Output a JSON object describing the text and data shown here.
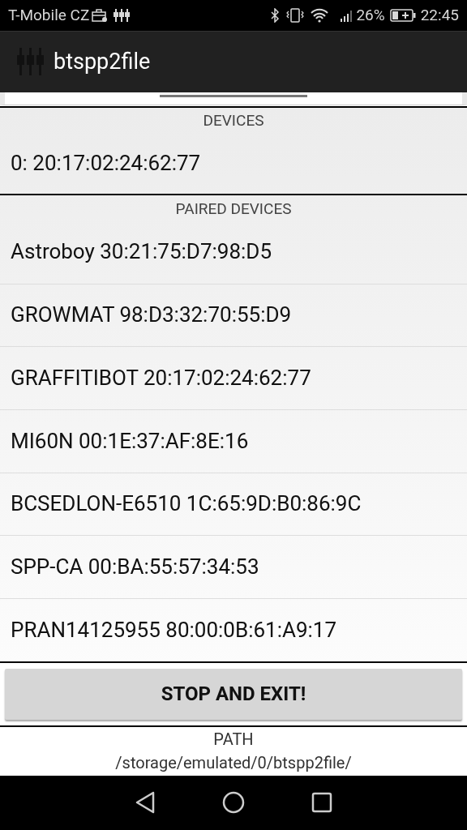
{
  "status_bar": {
    "carrier": "T-Mobile CZ",
    "battery": "26%",
    "time": "22:45"
  },
  "app_bar": {
    "title": "btspp2file"
  },
  "devices": {
    "header": "DEVICES",
    "items": [
      "0: 20:17:02:24:62:77"
    ]
  },
  "paired_devices": {
    "header": "PAIRED DEVICES",
    "items": [
      "Astroboy 30:21:75:D7:98:D5",
      "GROWMAT 98:D3:32:70:55:D9",
      "GRAFFITIBOT 20:17:02:24:62:77",
      "MI60N 00:1E:37:AF:8E:16",
      "BCSEDLON-E6510 1C:65:9D:B0:86:9C",
      "SPP-CA 00:BA:55:57:34:53",
      "PRAN14125955 80:00:0B:61:A9:17"
    ]
  },
  "button": "STOP AND EXIT!",
  "path": {
    "label": "PATH",
    "value": "/storage/emulated/0/btspp2file/"
  }
}
